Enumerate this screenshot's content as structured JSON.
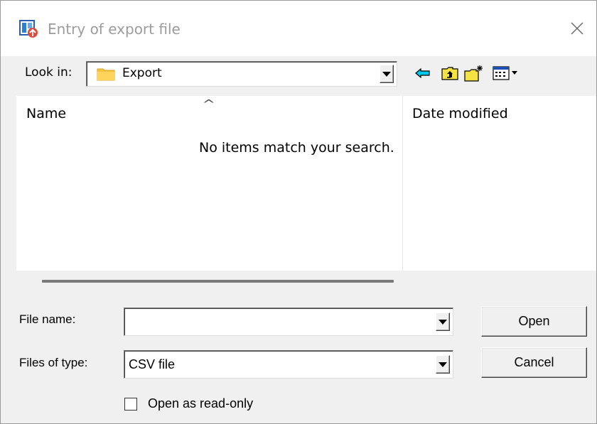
{
  "window": {
    "title": "Entry of export file",
    "icon": "export-app-icon",
    "close_icon": "close-icon"
  },
  "look_in": {
    "label": "Look in:",
    "value": "Export",
    "folder_icon": "folder-icon"
  },
  "toolbar": {
    "buttons": [
      {
        "name": "back",
        "icon": "back-arrow-icon"
      },
      {
        "name": "up-one-level",
        "icon": "up-folder-icon"
      },
      {
        "name": "create-new-folder",
        "icon": "new-folder-icon"
      },
      {
        "name": "view-menu",
        "icon": "view-menu-icon"
      }
    ]
  },
  "file_list": {
    "sort_indicator": "^",
    "columns": [
      "Name",
      "Date modified"
    ],
    "empty_message": "No items match your search."
  },
  "form": {
    "file_name_label": "File name:",
    "file_name_value": "",
    "files_of_type_label": "Files of type:",
    "files_of_type_value": "CSV file",
    "read_only_label": "Open as read-only",
    "read_only_checked": false
  },
  "buttons": {
    "open": "Open",
    "cancel": "Cancel"
  },
  "colors": {
    "window_bg": "#f0f0f0",
    "title_text": "#9c9c9c",
    "folder_yellow": "#f5c342",
    "arrow_cyan": "#00c8e8"
  }
}
